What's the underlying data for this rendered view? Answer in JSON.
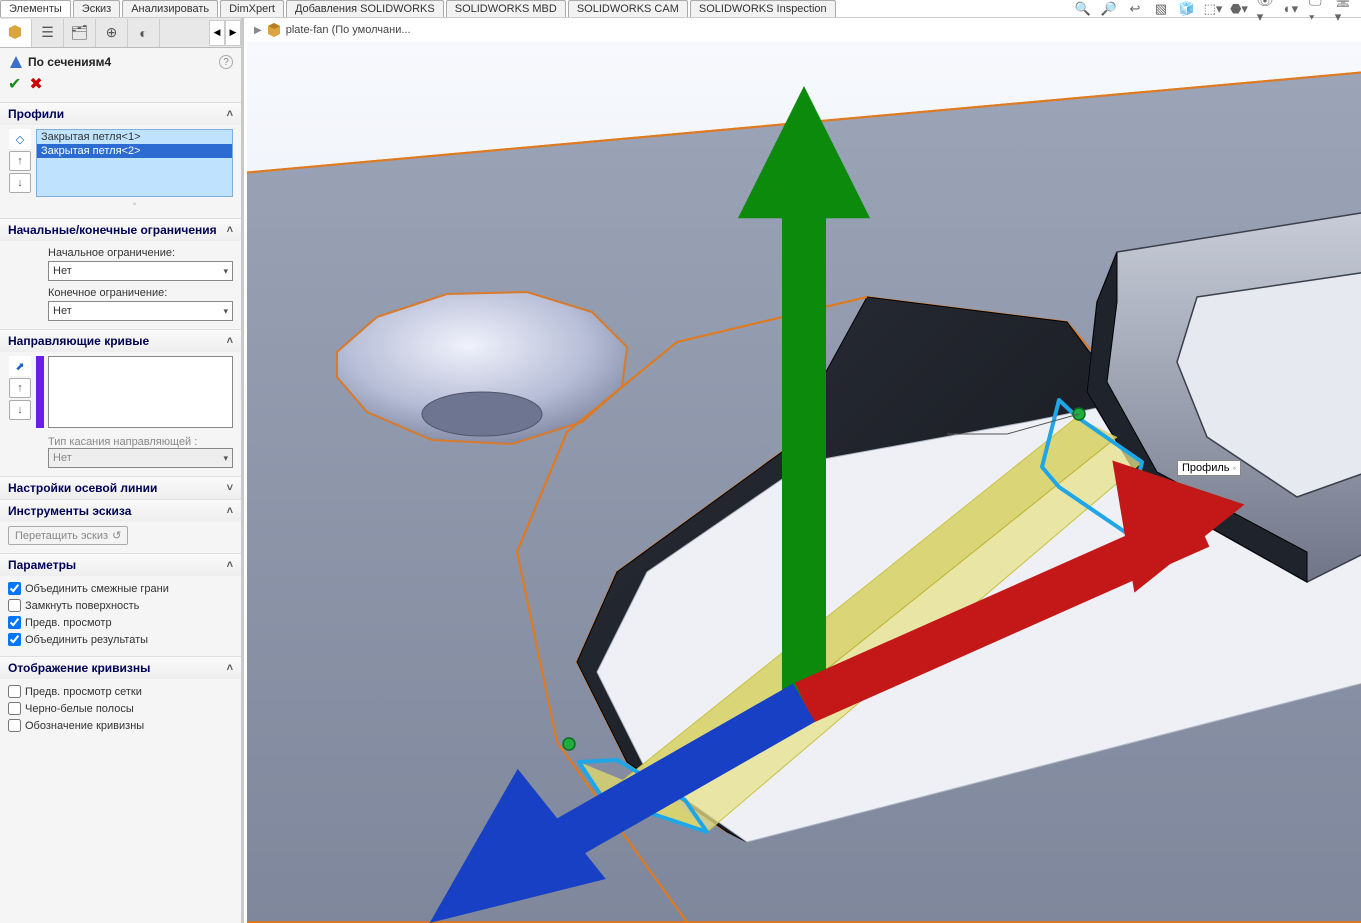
{
  "tabs": {
    "elements": "Элементы",
    "sketch": "Эскиз",
    "analyze": "Анализировать",
    "dimxpert": "DimXpert",
    "addins": "Добавления SOLIDWORKS",
    "mbd": "SOLIDWORKS MBD",
    "cam": "SOLIDWORKS CAM",
    "inspection": "SOLIDWORKS Inspection"
  },
  "breadcrumb": {
    "part_name": "plate-fan  (По умолчани..."
  },
  "feature": {
    "title": "По сечениям4"
  },
  "sections": {
    "profiles": {
      "title": "Профили",
      "items": [
        "Закрытая петля<1>",
        "Закрытая петля<2>"
      ],
      "selected_index": 1
    },
    "constraints": {
      "title": "Начальные/конечные ограничения",
      "start_label": "Начальное ограничение:",
      "start_value": "Нет",
      "end_label": "Конечное ограничение:",
      "end_value": "Нет"
    },
    "guides": {
      "title": "Направляющие кривые",
      "tangent_label": "Тип касания направляющей :",
      "tangent_value": "Нет"
    },
    "centerline": {
      "title": "Настройки осевой линии"
    },
    "sketchTools": {
      "title": "Инструменты эскиза",
      "drag_btn": "Перетащить эскиз"
    },
    "params": {
      "title": "Параметры",
      "merge_faces": "Объединить смежные грани",
      "close_surface": "Замкнуть поверхность",
      "preview": "Предв. просмотр",
      "merge_results": "Объединить результаты"
    },
    "curvature": {
      "title": "Отображение кривизны",
      "mesh_preview": "Предв. просмотр сетки",
      "zebra": "Черно-белые полосы",
      "curv_comb": "Обозначение кривизны"
    }
  },
  "viewport": {
    "profile_label": "Профиль"
  }
}
